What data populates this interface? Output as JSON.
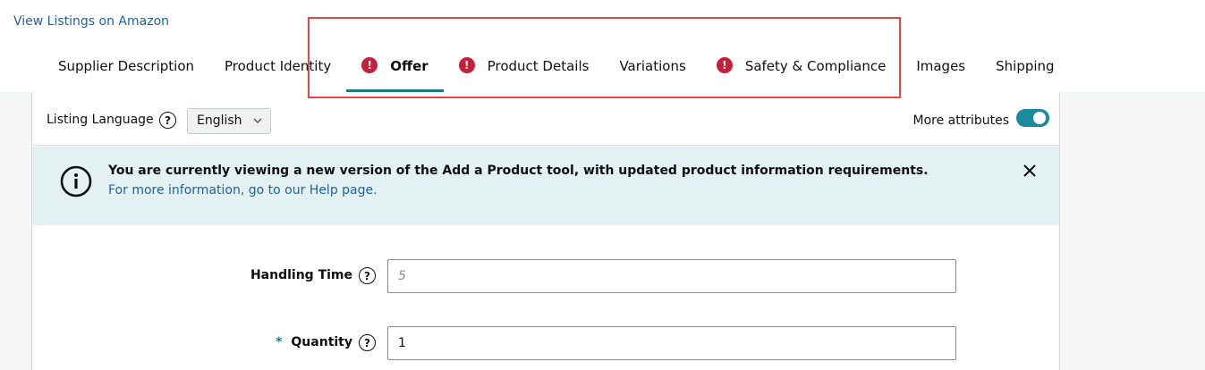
{
  "header": {
    "view_listings_link": "View Listings on Amazon"
  },
  "tabs": [
    {
      "label": "Supplier Description",
      "error": false,
      "active": false
    },
    {
      "label": "Product Identity",
      "error": false,
      "active": false
    },
    {
      "label": "Offer",
      "error": true,
      "active": true
    },
    {
      "label": "Product Details",
      "error": true,
      "active": false
    },
    {
      "label": "Variations",
      "error": false,
      "active": false
    },
    {
      "label": "Safety & Compliance",
      "error": true,
      "active": false
    },
    {
      "label": "Images",
      "error": false,
      "active": false
    },
    {
      "label": "Shipping",
      "error": false,
      "active": false
    }
  ],
  "icons": {
    "error": "exclamation-icon",
    "help": "question-mark-icon",
    "info": "info-icon",
    "close": "close-icon",
    "chevron": "chevron-down-icon"
  },
  "language_bar": {
    "label": "Listing Language",
    "help_glyph": "?",
    "selected": "English",
    "more_attributes_label": "More attributes",
    "more_attributes_on": true
  },
  "banner": {
    "title": "You are currently viewing a new version of the Add a Product tool, with updated product information requirements.",
    "link": "For more information, go to our Help page."
  },
  "form": {
    "handling_time": {
      "label": "Handling Time",
      "placeholder": "5",
      "value": ""
    },
    "quantity": {
      "label": "Quantity",
      "required_marker": "*",
      "value": "1"
    }
  },
  "colors": {
    "accent": "#1a7a8a",
    "link": "#2162a1",
    "error": "#c7203a",
    "banner_bg": "#e3f1f2",
    "highlight": "#e04646"
  }
}
